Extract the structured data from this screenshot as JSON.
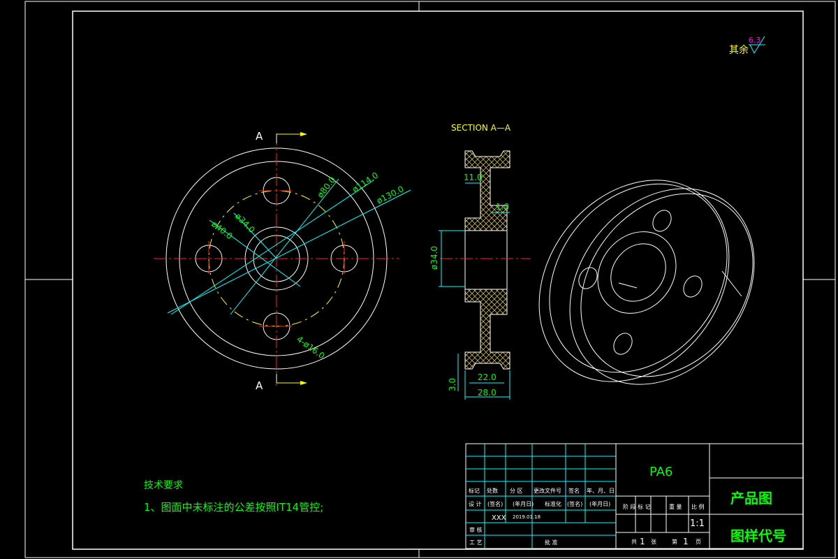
{
  "roughness": {
    "prefix": "其余",
    "value": "6.3"
  },
  "views": {
    "section_title": "SECTION A—A",
    "section_label": "A",
    "dims_front": {
      "d80": "ø80.0",
      "d114": "ø114.0",
      "d130": "ø130.0",
      "d34": "ø34.0",
      "d40": "ø40.0",
      "holes": "4-ø16.0"
    },
    "dims_section": {
      "d11": "11.0",
      "d1": "1.0",
      "d34": "ø34.0",
      "d22": "22.0",
      "d28": "28.0",
      "d3": "3.0"
    }
  },
  "notes": {
    "title": "技术要求",
    "line1": "1、图面中未标注的公差按照IT14管控;"
  },
  "title_block": {
    "material": "PA6",
    "product": "产品图",
    "drawing_no": "图样代号",
    "rev_header": [
      "标记",
      "处数",
      "分 区",
      "更改文件号",
      "签名",
      "年、月、日"
    ],
    "design_row": [
      "设 计",
      "(签名)",
      "(年月日)",
      "标准化",
      "(签名)",
      "(年月日)"
    ],
    "designer": "XXX",
    "date": "2019.01.18",
    "review": "审 核",
    "process": "工 艺",
    "approve": "批 准",
    "stage_header": [
      "阶 段 标 记",
      "重 量",
      "比 例"
    ],
    "scale": "1:1",
    "sheets_total_label": "共",
    "sheets_total": "1",
    "sheets_unit": "张",
    "sheet_no_label": "第",
    "sheet_no": "1",
    "sheet_unit": "页"
  },
  "colors": {
    "geometry": "#ffffff",
    "center": "#ff2020",
    "dimension": "#00ffff",
    "dimtext": "#00ff00",
    "label": "#ffff00",
    "hatch": "#c8b464",
    "accent": "#ff00ff"
  }
}
